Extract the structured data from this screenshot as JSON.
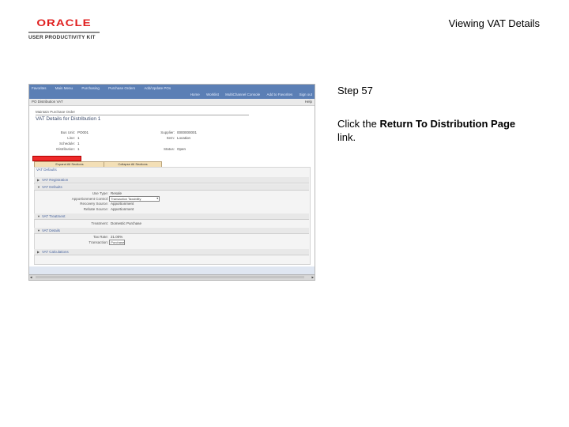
{
  "header": {
    "logo_brand": "ORACLE",
    "logo_product": "USER PRODUCTIVITY KIT",
    "page_title": "Viewing VAT Details"
  },
  "instructions": {
    "step": "Step 57",
    "text_before": "Click the ",
    "link_text": "Return To Distribution Page",
    "text_after": " link."
  },
  "screenshot": {
    "nav_row1": [
      "Favorites",
      "Main Menu",
      "Purchasing",
      "Purchase Orders",
      "Add/Update POs"
    ],
    "nav_row2": [
      "Home",
      "Worklist",
      "MultiChannel Console",
      "Add to Favorites",
      "Sign out"
    ],
    "breadcrumb": "PO Distribution VAT",
    "help_link": "Help",
    "context": "Maintain Purchase Order",
    "page_title": "VAT Details for Distribution 1",
    "fields": [
      {
        "label": "Bus Unit:",
        "value": "PO001"
      },
      {
        "label": "Line:",
        "value": "1"
      },
      {
        "label": "Schedule:",
        "value": "1"
      },
      {
        "label": "Distribution:",
        "value": "1"
      }
    ],
    "fields_right": [
      {
        "label": "Supplier:",
        "value": "0000000001"
      },
      {
        "label": "Item:",
        "value": "Location"
      },
      {
        "label": "Status:",
        "value": "Open"
      }
    ],
    "buttons": {
      "expand": "Expand All Sections",
      "collapse": "Collapse All Sections"
    },
    "sections": {
      "vat_defaults": "VAT Defaults",
      "vat_registration": "VAT Registration",
      "vat_defaults_detail": "VAT Defaults",
      "vat_treatment": "VAT Treatment",
      "vat_details": "VAT Details",
      "vat_calculations": "VAT Calculations"
    },
    "details": [
      {
        "label": "Use Type:",
        "value": "Resale"
      },
      {
        "label": "Apportionment Control:",
        "value": "Transaction Taxability"
      },
      {
        "label": "Recovery Source:",
        "value": "Apportionment"
      },
      {
        "label": "Rebate Source:",
        "value": "Apportionment"
      }
    ],
    "treatment": {
      "label": "Treatment:",
      "value": "Domestic Purchase"
    },
    "tax_rate": {
      "label": "Tax Rate:",
      "value": "21.00%"
    },
    "transaction": {
      "label": "Transaction:",
      "value": "Purchase"
    }
  }
}
